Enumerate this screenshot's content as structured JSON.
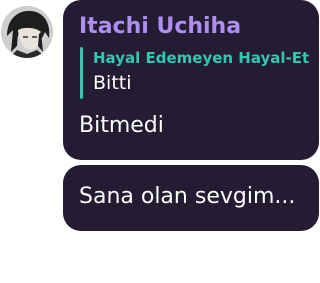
{
  "message": {
    "sender": "Itachi Uchiha",
    "reply": {
      "author": "Hayal Edemeyen Hayal-Et",
      "text": "Bitti"
    },
    "text": "Bitmedi"
  },
  "followup": {
    "text": "Sana olan sevgim..."
  },
  "colors": {
    "bubble_bg": "#241c33",
    "sender_name": "#ad8ff0",
    "reply_accent": "#33c7b2",
    "text": "#ffffff"
  },
  "icons": {
    "avatar": "user-avatar-photo"
  }
}
